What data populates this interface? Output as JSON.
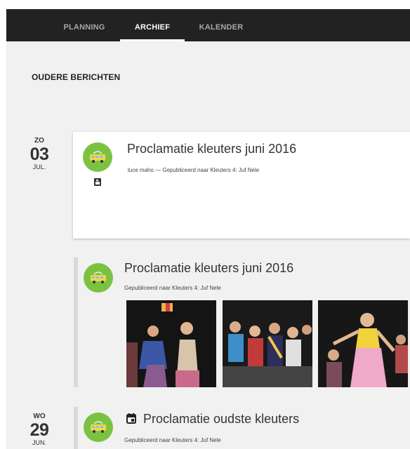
{
  "nav": {
    "tabs": [
      {
        "label": "PLANNING",
        "active": false
      },
      {
        "label": "ARCHIEF",
        "active": true
      },
      {
        "label": "KALENDER",
        "active": false
      }
    ]
  },
  "section_title": "OUDERE BERICHTEN",
  "groups": [
    {
      "dow": "ZO",
      "day": "03",
      "month": "JUL."
    },
    {
      "dow": "WO",
      "day": "29",
      "month": "JUN."
    }
  ],
  "posts": [
    {
      "title": "Proclamatie kleuters juni 2016",
      "meta": "luce maho — Gepubliceerd naar Kleuters 4: Juf Nele",
      "icon": "album-icon"
    },
    {
      "title": "Proclamatie kleuters juni 2016",
      "meta": "Gepubliceerd naar Kleuters 4: Juf Nele",
      "photos": [
        "photo-1",
        "photo-2",
        "photo-3"
      ]
    },
    {
      "title": "Proclamatie oudste kleuters",
      "meta": "Gepubliceerd naar Kleuters 4: Juf Nele",
      "icon": "calendar-icon"
    }
  ],
  "colors": {
    "nav_bg": "#222222",
    "page_bg": "#f1f1f1",
    "avatar_green": "#7cc242",
    "timeline_bar": "#d9d9d9"
  }
}
